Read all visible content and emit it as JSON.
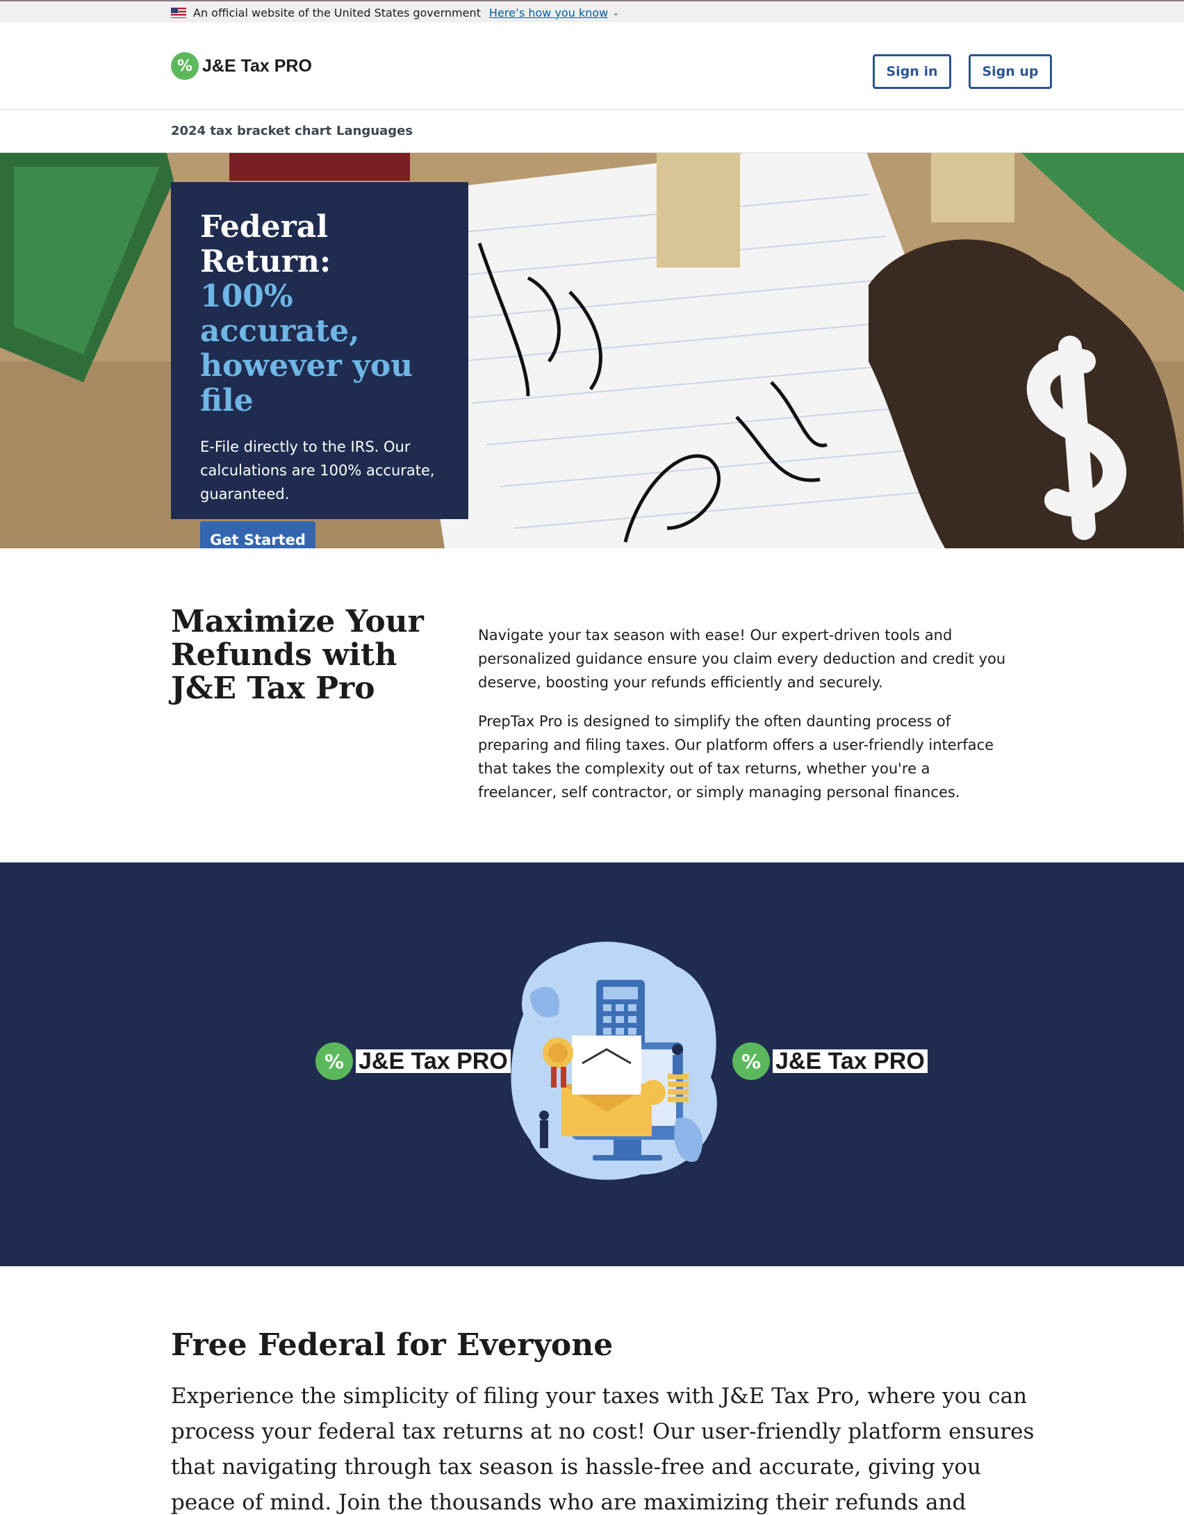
{
  "gov_banner": {
    "text": "An official website of the United States government",
    "link": "Here’s how you know"
  },
  "header": {
    "brand": "J&E Tax PRO",
    "sign_in": "Sign in",
    "sign_up": "Sign up"
  },
  "nav": {
    "items": [
      "2024 tax bracket chart",
      "Languages"
    ]
  },
  "hero": {
    "title": "Federal Return:",
    "accent": "100% accurate, however you file",
    "description": "E-File directly to the IRS. Our calculations are 100% accurate, guaranteed.",
    "cta": "Get Started"
  },
  "intro": {
    "title": "Maximize Your Refunds with J&E Tax Pro",
    "paragraphs": [
      "Navigate your tax season with ease! Our expert-driven tools and personalized guidance ensure you claim every deduction and credit you deserve, boosting your refunds efficiently and securely.",
      "PrepTax Pro is designed to simplify the often daunting process of preparing and filing taxes. Our platform offers a user-friendly interface that takes the complexity out of tax returns, whether you're a freelancer, self contractor, or simply managing personal finances."
    ]
  },
  "band": {
    "brand_left": "J&E Tax PRO",
    "brand_right": "J&E Tax PRO"
  },
  "free": {
    "title": "Free Federal for Everyone",
    "body": "Experience the simplicity of filing your taxes with J&E Tax Pro, where you can process your federal tax returns at no cost! Our user-friendly platform ensures that navigating through tax season is hassle-free and accurate, giving you peace of mind. Join the thousands who are maximizing their refunds and minimizing their tax burdens without"
  },
  "colors": {
    "navy": "#1f2c4f",
    "accent_blue": "#6fb6e6",
    "button_blue": "#3466b0",
    "outline_blue": "#2b5592",
    "brand_green": "#5cb85c"
  },
  "icons": [
    "us-flag-icon",
    "chevron-down-icon",
    "percent-logo-icon",
    "tax-illustration"
  ]
}
